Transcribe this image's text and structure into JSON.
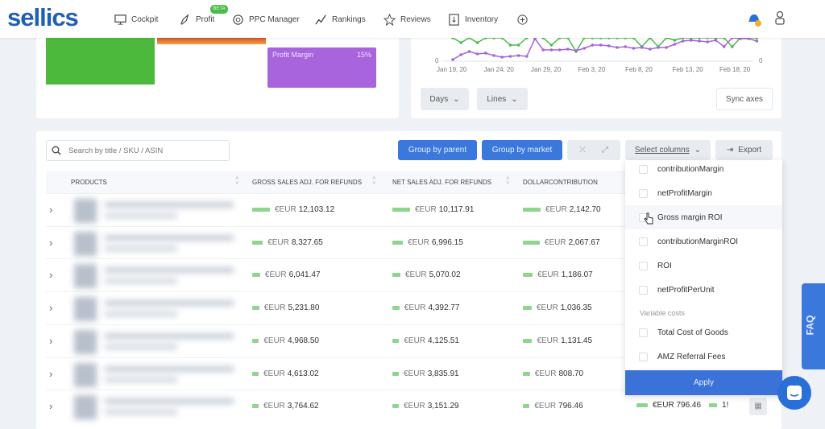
{
  "header": {
    "logo": "sellics",
    "nav": [
      {
        "label": "Cockpit",
        "icon": "monitor-icon"
      },
      {
        "label": "Profit",
        "icon": "rocket-icon",
        "badge": "BETA"
      },
      {
        "label": "PPC Manager",
        "icon": "target-icon"
      },
      {
        "label": "Rankings",
        "icon": "trend-icon"
      },
      {
        "label": "Reviews",
        "icon": "star-icon"
      },
      {
        "label": "Inventory",
        "icon": "box-icon"
      }
    ],
    "add_icon": "plus-circle-icon"
  },
  "top_left": {
    "profit_margin_label": "Profit Margin",
    "profit_margin_value": "15%"
  },
  "top_right": {
    "y_axis_left": "0",
    "y_axis_right": "0",
    "x_ticks": [
      "Jan 19, 20",
      "Jan 24, 20",
      "Jan 29, 20",
      "Feb 3, 20",
      "Feb 8, 20",
      "Feb 13, 20",
      "Feb 18, 20"
    ],
    "days": "Days",
    "lines": "Lines",
    "sync": "Sync axes"
  },
  "toolbar": {
    "search_placeholder": "Search by title / SKU / ASIN",
    "group_parent": "Group by parent",
    "group_market": "Group by market",
    "select_columns": "Select columns",
    "export": "Export"
  },
  "table": {
    "headers": [
      "Products",
      "Gross sales adj. for refunds",
      "Net sales adj. for refunds",
      "Dollarcontribution"
    ],
    "rows": [
      {
        "gross": "12,103.12",
        "net": "10,117.91",
        "dollar": "2,142.70",
        "g": 1,
        "n": 1,
        "d": 1
      },
      {
        "gross": "8,327.65",
        "net": "6,996.15",
        "dollar": "2,067.67",
        "g": 0.6,
        "n": 0.6,
        "d": 0.95
      },
      {
        "gross": "6,041.47",
        "net": "5,070.02",
        "dollar": "1,186.07",
        "g": 0.45,
        "n": 0.45,
        "d": 0.55
      },
      {
        "gross": "5,231.80",
        "net": "4,392.77",
        "dollar": "1,036.35",
        "g": 0.4,
        "n": 0.4,
        "d": 0.5
      },
      {
        "gross": "4,968.50",
        "net": "4,125.51",
        "dollar": "1,131.45",
        "g": 0.38,
        "n": 0.38,
        "d": 0.52
      },
      {
        "gross": "4,613.02",
        "net": "3,835.91",
        "dollar": "808.70",
        "g": 0.35,
        "n": 0.35,
        "d": 0.4
      },
      {
        "gross": "3,764.62",
        "net": "3,151.29",
        "dollar": "796.46",
        "g": 0.3,
        "n": 0.3,
        "d": 0.38
      }
    ],
    "currency": "€EUR",
    "extra_last_row": "€EUR 796.46",
    "extra_partial": "1!"
  },
  "dropdown": {
    "options": [
      "contributionMargin",
      "netProfitMargin",
      "Gross margin ROI",
      "contributionMarginROI",
      "ROI",
      "netProfitPerUnit"
    ],
    "section": "Variable costs",
    "section_options": [
      "Total Cost of Goods",
      "AMZ Referral Fees"
    ],
    "apply": "Apply"
  },
  "faq": "FAQ",
  "colors": {
    "brand": "#1f5fb5",
    "primary": "#3b78dc",
    "green": "#4cbb4c",
    "purple": "#a764dd"
  }
}
